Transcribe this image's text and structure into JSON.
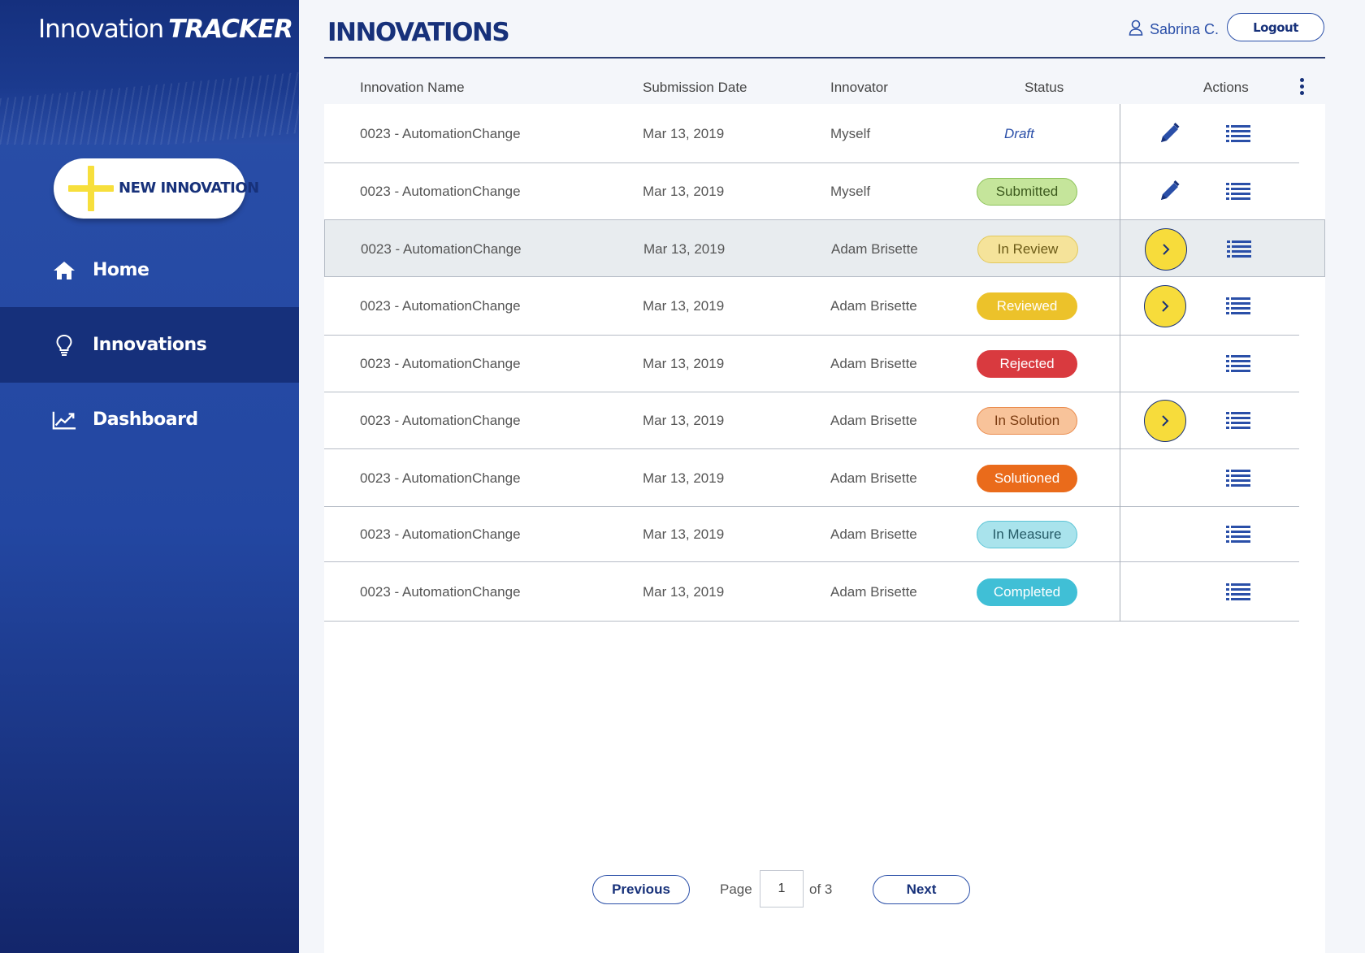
{
  "sidebar": {
    "brand_main": "Innovation",
    "brand_em": "TRACKER",
    "brand_chev": ">>",
    "new_button": "NEW INNOVATION",
    "items": [
      {
        "label": "Home",
        "icon": "home-icon"
      },
      {
        "label": "Innovations",
        "icon": "lightbulb-icon"
      },
      {
        "label": "Dashboard",
        "icon": "chart-icon"
      }
    ],
    "active": "Innovations"
  },
  "header": {
    "title": "INNOVATIONS",
    "user_name": "Sabrina C.",
    "logout": "Logout"
  },
  "table": {
    "columns": [
      "Innovation Name",
      "Submission Date",
      "Innovator",
      "Status",
      "Actions"
    ],
    "rows": [
      {
        "name": "0023 - AutomationChange",
        "date": "Mar 13, 2019",
        "innovator": "Myself",
        "status": "Draft",
        "actions": [
          "edit",
          "list"
        ]
      },
      {
        "name": "0023 - AutomationChange",
        "date": "Mar 13, 2019",
        "innovator": "Myself",
        "status": "Submitted",
        "actions": [
          "edit",
          "list"
        ]
      },
      {
        "name": "0023 - AutomationChange",
        "date": "Mar 13, 2019",
        "innovator": "Adam Brisette",
        "status": "In Review",
        "actions": [
          "go",
          "list"
        ],
        "highlighted": true
      },
      {
        "name": "0023 - AutomationChange",
        "date": "Mar 13, 2019",
        "innovator": "Adam Brisette",
        "status": "Reviewed",
        "actions": [
          "go",
          "list"
        ]
      },
      {
        "name": "0023 - AutomationChange",
        "date": "Mar 13, 2019",
        "innovator": "Adam Brisette",
        "status": "Rejected",
        "actions": [
          "list"
        ]
      },
      {
        "name": "0023 - AutomationChange",
        "date": "Mar 13, 2019",
        "innovator": "Adam Brisette",
        "status": "In Solution",
        "actions": [
          "go",
          "list"
        ]
      },
      {
        "name": "0023 - AutomationChange",
        "date": "Mar 13, 2019",
        "innovator": "Adam Brisette",
        "status": "Solutioned",
        "actions": [
          "list"
        ]
      },
      {
        "name": "0023 - AutomationChange",
        "date": "Mar 13, 2019",
        "innovator": "Adam Brisette",
        "status": "In Measure",
        "actions": [
          "list"
        ]
      },
      {
        "name": "0023 - AutomationChange",
        "date": "Mar 13, 2019",
        "innovator": "Adam Brisette",
        "status": "Completed",
        "actions": [
          "list"
        ]
      }
    ]
  },
  "status_colors": {
    "Submitted": {
      "bg": "#c5e59b",
      "border": "#8dc35a",
      "text": "#3d5a1e"
    },
    "In Review": {
      "bg": "#f5e39a",
      "border": "#e2c95c",
      "text": "#6b5a16"
    },
    "Reviewed": {
      "bg": "#ecc22a",
      "border": "#ecc22a",
      "text": "#ffffff"
    },
    "Rejected": {
      "bg": "#d93a3f",
      "border": "#d93a3f",
      "text": "#ffffff"
    },
    "In Solution": {
      "bg": "#f8c39a",
      "border": "#ea8b4d",
      "text": "#7a3b10"
    },
    "Solutioned": {
      "bg": "#ea6b1b",
      "border": "#ea6b1b",
      "text": "#ffffff"
    },
    "In Measure": {
      "bg": "#a9e3ec",
      "border": "#5cc4d6",
      "text": "#245a66"
    },
    "Completed": {
      "bg": "#40bfd6",
      "border": "#40bfd6",
      "text": "#ffffff"
    }
  },
  "pagination": {
    "previous": "Previous",
    "page_label": "Page",
    "current": "1",
    "of_label": "of 3",
    "next": "Next"
  }
}
